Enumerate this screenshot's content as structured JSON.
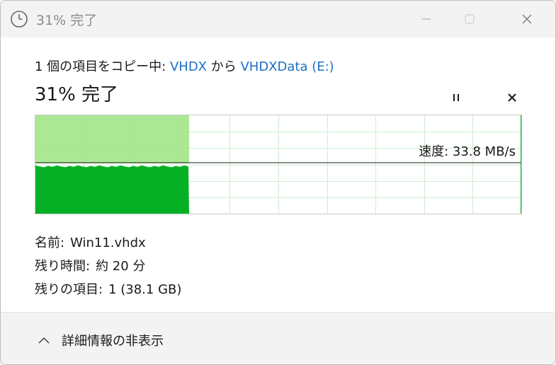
{
  "titlebar": {
    "title": "31% 完了",
    "icon": "clock-icon"
  },
  "copy": {
    "prefix": "1 個の項目をコピー中: ",
    "source": "VHDX",
    "middle": " から ",
    "destination": "VHDXData (E:)"
  },
  "status": {
    "percent_text": "31% 完了",
    "progress": 0.31
  },
  "controls": {
    "pause_icon": "pause-icon",
    "cancel_icon": "close-icon"
  },
  "graph": {
    "speed_text": "速度: 33.8 MB/s",
    "fill_color": "#06b025",
    "upper_color": "#a8e690",
    "grid_color": "#cfeccf"
  },
  "details": {
    "name_label": "名前:",
    "name_value": "Win11.vhdx",
    "time_label": "残り時間:",
    "time_value": "約 20 分",
    "items_label": "残りの項目:",
    "items_value": "1 (38.1 GB)"
  },
  "footer": {
    "toggle_label": "詳細情報の非表示"
  }
}
